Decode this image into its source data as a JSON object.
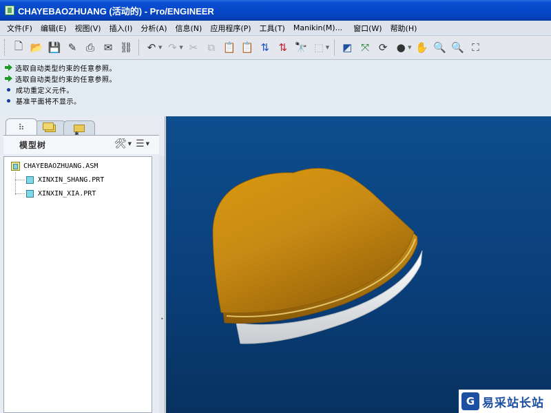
{
  "window": {
    "title": "CHAYEBAOZHUANG (活动的) - Pro/ENGINEER"
  },
  "menubar": {
    "items": [
      "文件(F)",
      "编辑(E)",
      "视图(V)",
      "插入(I)",
      "分析(A)",
      "信息(N)",
      "应用程序(P)",
      "工具(T)",
      "Manikin(M)...",
      "窗口(W)",
      "帮助(H)"
    ]
  },
  "toolbar": {
    "icons": [
      "new-file-icon",
      "open-folder-icon",
      "save-icon",
      "edit-icon",
      "print-icon",
      "send-mail-icon",
      "link-icon",
      "undo-icon",
      "redo-icon",
      "cut-icon",
      "copy-icon",
      "paste-icon",
      "paste-special-icon",
      "regenerate-icon",
      "regenerate-manager-icon",
      "find-icon",
      "select-box-icon",
      "orient-icon",
      "datum-axis-icon",
      "spin-center-icon",
      "shading-sphere-icon",
      "pan-hand-icon",
      "zoom-in-icon",
      "zoom-out-icon",
      "refit-icon"
    ]
  },
  "messages": [
    {
      "type": "prompt",
      "text": "选取自动类型约束的任意参照。"
    },
    {
      "type": "prompt",
      "text": "选取自动类型约束的任意参照。"
    },
    {
      "type": "info",
      "text": "成功重定义元件。"
    },
    {
      "type": "info",
      "text": "基准平面将不显示。"
    }
  ],
  "model_tree": {
    "title": "模型树",
    "root": "CHAYEBAOZHUANG.ASM",
    "children": [
      "XINXIN_SHANG.PRT",
      "XINXIN_XIA.PRT"
    ]
  },
  "colors": {
    "lid_gold": "#c88a14",
    "base_white": "#e8ecef",
    "viewport_blue": "#0a3f7a"
  },
  "watermark": {
    "logo": "G",
    "text": "易采站长站"
  }
}
